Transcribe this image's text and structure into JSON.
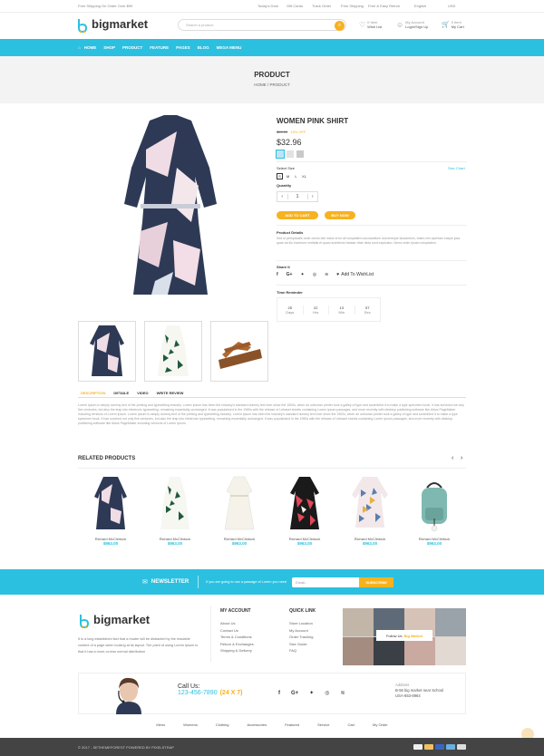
{
  "topbar": {
    "left_text": "Free Shipping On Order Over $99",
    "links": [
      "Today's Deal",
      "Gift Cards",
      "Track Order",
      "Free Shipping",
      "Free & Easy Return"
    ],
    "language": "English",
    "currency": "USD"
  },
  "header": {
    "logo_text": "bigmarket",
    "search_placeholder": "Search a product",
    "wishlist": {
      "count": "0 Item",
      "label": "Wish List"
    },
    "account": {
      "line1": "My Account",
      "line2": "Login/Sign Up"
    },
    "cart": {
      "count": "0 Item",
      "label": "My Cart"
    }
  },
  "nav": [
    "HOME",
    "SHOP",
    "PRODUCT",
    "FEATURE",
    "PAGES",
    "BLOG",
    "MEGA MENU"
  ],
  "banner": {
    "title": "PRODUCT",
    "breadcrumb": "HOME / PRODUCT"
  },
  "product": {
    "title": "WOMEN PINK SHIRT",
    "old_price": "$89.00",
    "discount": "15% OFF",
    "price": "$32.96",
    "colors": [
      "#bfe4f5",
      "#e2e2e2",
      "#c9c9c9"
    ],
    "size_label": "Select Size",
    "size_chart": "Size Chart",
    "sizes": [
      "S",
      "M",
      "L",
      "XL"
    ],
    "quantity_label": "Quantity",
    "quantity": "1",
    "add_to_cart": "ADD TO CART",
    "buy_now": "BUY NOW",
    "details_label": "Product Details",
    "details_text": "Sed ut perspiciatis unde omnis iste natus error sit voluptatem accusantium doloremque laudantium, totam rem aperiam eaque ipsa quae ab illo inventore veritatis et quasi architecto beatae vitae dicta sunt explicabo. Nemo enim ipsam voluptatem.",
    "share_label": "Share It",
    "wishlist_label": "Add To WishList",
    "timer_label": "Time Reminder",
    "timer": [
      {
        "value": "25",
        "unit": "Days"
      },
      {
        "value": "22",
        "unit": "Hrs"
      },
      {
        "value": "13",
        "unit": "Min"
      },
      {
        "value": "57",
        "unit": "Sec"
      }
    ]
  },
  "tabs": [
    "DESCRIPTION",
    "DETAILE",
    "VIDEO",
    "WRITE REVIEW"
  ],
  "description": "Lorem Ipsum is simply dummy text of the printing and typesetting industry. Lorem Ipsum has been the industry's standard dummy text ever since the 1500s, when an unknown printer took a galley of type and scrambled it to make a type specimen book. It has survived not only five centuries, but also the leap into electronic typesetting, remaining essentially unchanged. It was popularised in the 1960s with the release of Letraset sheets containing Lorem Ipsum passages, and more recently with desktop publishing software like Aldus PageMaker including versions of Lorem Ipsum. Lorem Ipsum is simply dummy text of the printing and typesetting industry. Lorem Ipsum has been the industry's standard dummy text ever since the 1500s, when an unknown printer took a galley of type and scrambled it to make a type specimen book. It has survived not only five centuries, but also the leap into electronic typesetting, remaining essentially unchanged. It was popularised in the 1960s with the release of Letraset sheets containing Lorem Ipsum passages, and more recently with desktop publishing software like Aldus PageMaker including versions of Lorem Ipsum.",
  "related": {
    "title": "RELATED PRODUCTS",
    "items": [
      {
        "name": "Richard McClintock",
        "price": "$963.00"
      },
      {
        "name": "Richard McClintock",
        "price": "$963.00"
      },
      {
        "name": "Richard McClintock",
        "price": "$963.00"
      },
      {
        "name": "Richard McClintock",
        "price": "$963.00"
      },
      {
        "name": "Richard McClintock",
        "price": "$963.00"
      },
      {
        "name": "Richard McClintock",
        "price": "$963.00"
      }
    ]
  },
  "newsletter": {
    "title": "NEWSLETTER",
    "text": "If you are going to use a passage of Lorem you need",
    "placeholder": "Email...",
    "button": "SUBSCRIBE"
  },
  "footer": {
    "logo_text": "bigmarket",
    "about": "It is a long established fact that a reader will be distracted by the readable content of a page when looking at its layout. The point of using Lorem Ipsum is that it has a more-or-less normal distribution",
    "account_title": "MY ACCOUNT",
    "account_links": [
      "About Us",
      "Contact Us",
      "Terms & Conditions",
      "Return & Exchanges",
      "Shipping & Delivery"
    ],
    "quick_title": "QUICK LINK",
    "quick_links": [
      "Store Location",
      "My Account",
      "Order Tracking",
      "Size Guide",
      "FAQ"
    ],
    "instagram_caption": "Follow Us",
    "instagram_handle": "Big Market",
    "call_label": "Call Us:",
    "phone": "123-456-7890",
    "hours": "(24 X 7)",
    "address_label": "Address",
    "address": "B-56 big market near School",
    "address_phone": "USA-653-8964",
    "menu": [
      "Mens",
      "Womens",
      "Clothing",
      "Accessories",
      "Featured",
      "Service",
      "Cart",
      "My Order"
    ],
    "copyright": "© 2017 - SETHEMEFOREST POWERED BY PIXELSTRAP"
  },
  "colors": {
    "accent": "#2cc0e0",
    "button": "#f7b21f",
    "discount": "#f7b21f"
  }
}
